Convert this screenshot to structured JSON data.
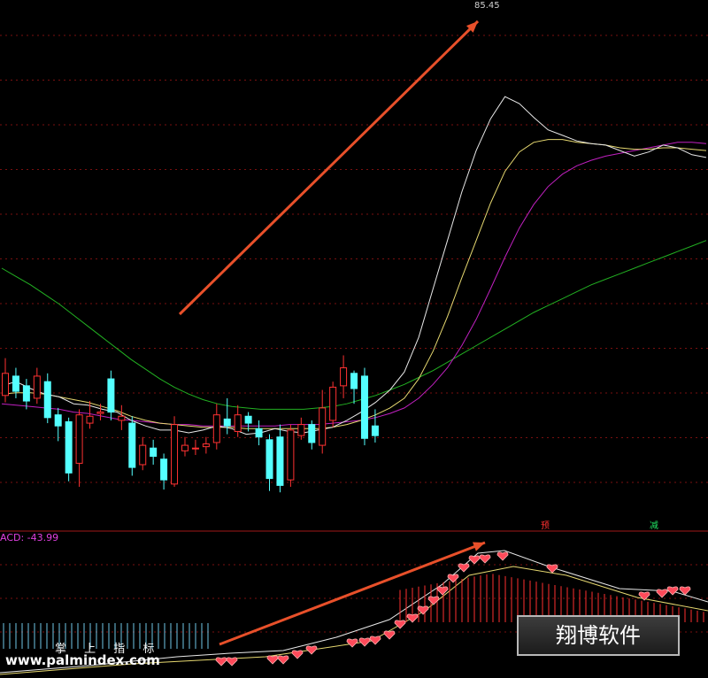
{
  "chart_data": [
    {
      "type": "candlestick",
      "panel": "price",
      "high_marker": "85.45",
      "moving_averages": {
        "ma_white": [
          60.5,
          60.8,
          60.3,
          59.9,
          59.7,
          59.2,
          59.1,
          58.8,
          58.6,
          58.0,
          57.6,
          57.3,
          57.3,
          57.1,
          57.3,
          57.6,
          57.4,
          57.0,
          57.1,
          57.4,
          57.2,
          57.1,
          57.3,
          57.5,
          58.0,
          58.6,
          59.3,
          60.2,
          61.5,
          64.0,
          67.5,
          71.0,
          74.5,
          77.5,
          79.8,
          81.4,
          80.9,
          79.9,
          79.0,
          78.6,
          78.2,
          78.0,
          77.9,
          77.5,
          77.1,
          77.4,
          77.9,
          77.7,
          77.2,
          77.0
        ],
        "ma_yellow": [
          59.9,
          60.0,
          60.0,
          59.9,
          59.7,
          59.5,
          59.3,
          59.0,
          58.7,
          58.3,
          58.0,
          57.8,
          57.7,
          57.6,
          57.5,
          57.5,
          57.5,
          57.4,
          57.4,
          57.4,
          57.4,
          57.4,
          57.4,
          57.5,
          57.7,
          58.0,
          58.4,
          58.9,
          59.6,
          61.0,
          63.0,
          65.5,
          68.3,
          71.0,
          73.7,
          76.0,
          77.4,
          78.1,
          78.3,
          78.3,
          78.1,
          78.0,
          77.9,
          77.7,
          77.6,
          77.6,
          77.7,
          77.7,
          77.6,
          77.5
        ],
        "ma_magenta": [
          59.2,
          59.1,
          59.0,
          58.9,
          58.8,
          58.6,
          58.5,
          58.3,
          58.1,
          58.0,
          57.9,
          57.8,
          57.7,
          57.7,
          57.6,
          57.6,
          57.6,
          57.6,
          57.6,
          57.6,
          57.7,
          57.7,
          57.7,
          57.8,
          57.9,
          58.0,
          58.2,
          58.5,
          58.9,
          59.6,
          60.6,
          61.8,
          63.4,
          65.3,
          67.5,
          69.8,
          71.9,
          73.6,
          74.9,
          75.8,
          76.4,
          76.8,
          77.1,
          77.3,
          77.5,
          77.7,
          77.9,
          78.1,
          78.1,
          78.0
        ],
        "ma_green": [
          69.0,
          68.4,
          67.8,
          67.1,
          66.4,
          65.6,
          64.8,
          64.0,
          63.2,
          62.4,
          61.7,
          61.0,
          60.4,
          59.9,
          59.5,
          59.2,
          59.0,
          58.9,
          58.8,
          58.8,
          58.8,
          58.8,
          58.9,
          59.0,
          59.2,
          59.5,
          59.8,
          60.2,
          60.6,
          61.1,
          61.6,
          62.2,
          62.8,
          63.4,
          64.0,
          64.6,
          65.2,
          65.8,
          66.3,
          66.8,
          67.3,
          67.8,
          68.2,
          68.6,
          69.0,
          69.4,
          69.8,
          70.2,
          70.6,
          71.0
        ]
      },
      "candles": [
        {
          "o": 59.8,
          "c": 61.4,
          "h": 62.5,
          "l": 59.3
        },
        {
          "o": 61.2,
          "c": 60.1,
          "h": 61.8,
          "l": 59.6
        },
        {
          "o": 60.5,
          "c": 59.4,
          "h": 61.0,
          "l": 58.8
        },
        {
          "o": 59.6,
          "c": 61.2,
          "h": 61.8,
          "l": 59.2
        },
        {
          "o": 60.8,
          "c": 58.2,
          "h": 61.4,
          "l": 57.8
        },
        {
          "o": 58.4,
          "c": 57.6,
          "h": 58.9,
          "l": 56.5
        },
        {
          "o": 57.9,
          "c": 54.2,
          "h": 58.2,
          "l": 53.6
        },
        {
          "o": 54.9,
          "c": 58.4,
          "h": 58.8,
          "l": 53.2
        },
        {
          "o": 57.8,
          "c": 58.3,
          "h": 59.4,
          "l": 57.4
        },
        {
          "o": 58.5,
          "c": 58.6,
          "h": 59.2,
          "l": 58.0
        },
        {
          "o": 61.0,
          "c": 58.6,
          "h": 61.6,
          "l": 58.0
        },
        {
          "o": 58.0,
          "c": 58.3,
          "h": 59.1,
          "l": 57.3
        },
        {
          "o": 57.8,
          "c": 54.6,
          "h": 58.3,
          "l": 54.0
        },
        {
          "o": 54.8,
          "c": 56.2,
          "h": 56.8,
          "l": 54.4
        },
        {
          "o": 56.0,
          "c": 55.4,
          "h": 56.6,
          "l": 54.8
        },
        {
          "o": 55.2,
          "c": 53.7,
          "h": 55.6,
          "l": 53.0
        },
        {
          "o": 53.4,
          "c": 57.7,
          "h": 58.3,
          "l": 53.2
        },
        {
          "o": 55.8,
          "c": 56.2,
          "h": 56.8,
          "l": 55.4
        },
        {
          "o": 56.0,
          "c": 56.0,
          "h": 56.6,
          "l": 55.5
        },
        {
          "o": 56.1,
          "c": 56.3,
          "h": 56.8,
          "l": 55.6
        },
        {
          "o": 56.4,
          "c": 58.4,
          "h": 59.2,
          "l": 55.9
        },
        {
          "o": 58.1,
          "c": 57.6,
          "h": 59.6,
          "l": 57.0
        },
        {
          "o": 57.2,
          "c": 58.4,
          "h": 59.1,
          "l": 56.8
        },
        {
          "o": 58.3,
          "c": 57.8,
          "h": 58.6,
          "l": 57.2
        },
        {
          "o": 57.4,
          "c": 56.8,
          "h": 58.0,
          "l": 56.2
        },
        {
          "o": 56.6,
          "c": 53.8,
          "h": 57.0,
          "l": 52.9
        },
        {
          "o": 56.8,
          "c": 53.3,
          "h": 57.7,
          "l": 52.8
        },
        {
          "o": 53.7,
          "c": 57.3,
          "h": 57.7,
          "l": 53.2
        },
        {
          "o": 56.9,
          "c": 57.7,
          "h": 58.2,
          "l": 56.6
        },
        {
          "o": 57.7,
          "c": 56.4,
          "h": 58.0,
          "l": 55.9
        },
        {
          "o": 56.2,
          "c": 58.9,
          "h": 60.2,
          "l": 55.6
        },
        {
          "o": 58.0,
          "c": 60.4,
          "h": 60.8,
          "l": 57.5
        },
        {
          "o": 60.5,
          "c": 61.8,
          "h": 62.7,
          "l": 59.6
        },
        {
          "o": 61.4,
          "c": 60.3,
          "h": 61.6,
          "l": 59.2
        },
        {
          "o": 61.2,
          "c": 56.7,
          "h": 61.8,
          "l": 56.2
        },
        {
          "o": 57.6,
          "c": 56.9,
          "h": 58.8,
          "l": 56.4
        }
      ]
    },
    {
      "type": "line",
      "panel": "indicator",
      "label": "ACD: -43.99",
      "signals": {
        "buy": "预",
        "sell": "减"
      }
    }
  ],
  "watermark": {
    "cn_text": "掌 上 指 标",
    "url": "www.palmindex.com"
  },
  "brand": {
    "label": "翔博软件"
  }
}
